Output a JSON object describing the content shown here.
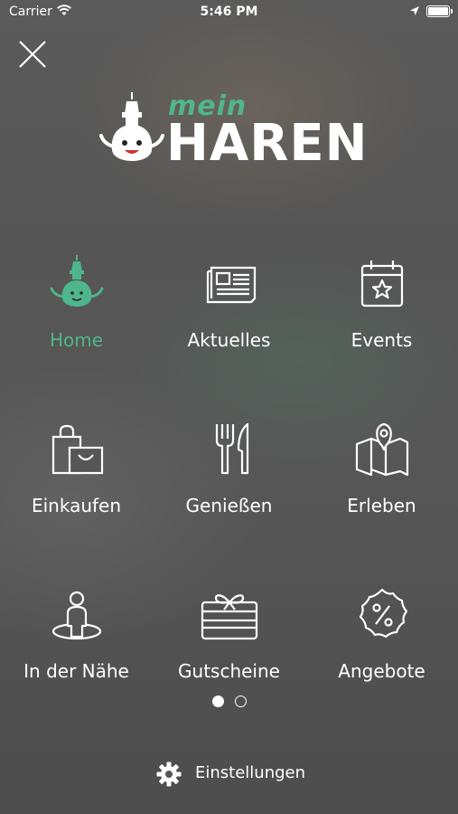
{
  "status_bar": {
    "carrier": "Carrier",
    "time": "5:46 PM"
  },
  "brand": {
    "mein": "mein",
    "haren": "HAREN",
    "accent": "#4fb58d"
  },
  "menu": [
    {
      "label": "Home",
      "icon": "mascot-icon",
      "active": true
    },
    {
      "label": "Aktuelles",
      "icon": "newspaper-icon"
    },
    {
      "label": "Events",
      "icon": "calendar-star-icon"
    },
    {
      "label": "Einkaufen",
      "icon": "shopping-bags-icon"
    },
    {
      "label": "Genießen",
      "icon": "fork-knife-icon"
    },
    {
      "label": "Erleben",
      "icon": "map-icon"
    },
    {
      "label": "In der Nähe",
      "icon": "person-location-icon"
    },
    {
      "label": "Gutscheine",
      "icon": "gift-card-icon"
    },
    {
      "label": "Angebote",
      "icon": "percent-badge-icon"
    }
  ],
  "pager": {
    "current": 1,
    "total": 2
  },
  "settings": {
    "label": "Einstellungen"
  }
}
